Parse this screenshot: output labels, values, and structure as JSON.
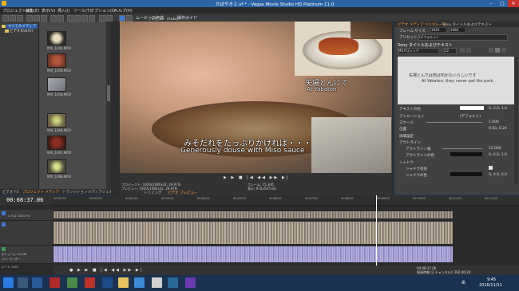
{
  "window": {
    "title": "かぼやき２.vf * - Vegas Movie Studio HD Platinum 11.0",
    "controls": [
      "–",
      "□",
      "✕"
    ]
  },
  "menu": [
    "プロジェクト(P)",
    "編集(E)",
    "表示(V)",
    "挿入(I)",
    "ツール(T)",
    "オプション(O)",
    "ヘルプ(H)"
  ],
  "toolbar": {
    "movie_maker_label": "ムービーの作成",
    "ops_guide_label": "操作ガイド"
  },
  "media_tree": {
    "items": [
      "すべてのメディア",
      "ビデオのみ(V)"
    ]
  },
  "media_files": [
    "MVI_1044.MOV",
    "MVI_1050.MOV",
    "MVI_1058.MOV",
    "MVI_1066.MOV",
    "MVI_1067.MOV",
    "MVI_1068.MOV"
  ],
  "left_tabs": [
    "ビデオ FX",
    "プロジェクト メディア",
    "トランジション",
    "メディアジェネレ"
  ],
  "preview": {
    "toolbar_label": "プレビュー (Auto)",
    "subtitle_jp_main": "みそだれをたっぷりかければ・・・",
    "subtitle_en_main": "Generously douse with Miso sauce",
    "inset_jp": "矢場とんにて",
    "inset_en": "At Yabaton.",
    "info_left_1": "プロジェクト: 1920x1080x32, 29.970i",
    "info_left_2": "プレビュー: 1920x1080x32, 29.970i",
    "info_left_3": "ビデオ プレビュー",
    "info_right_1": "フレーム: 15,300",
    "info_right_2": "表示: 970x547x32",
    "tabs": [
      "トリミング",
      "ビデオ プレビュー"
    ]
  },
  "inspector": {
    "tabs": [
      "ビデオ メディア ジェネレータ"
    ],
    "header": "Sony タイトルおよびテキスト",
    "frame_size_label": "フレーム サイズ",
    "frame_w": "1920",
    "frame_h": "1080",
    "preset_label": "プリセット",
    "preset_value": "(デフォルト)",
    "font_title": "Sony タイトルおよびテキスト",
    "font_name": "MS Pゴシック",
    "font_size": "12",
    "preview_jp": "矢場とんでは肉は叩かないらしいです",
    "preview_en": "At Yabaton, they never pat the pork.",
    "rows": [
      {
        "label": "テキストの色",
        "value": "0, 0.0, 1.0"
      },
      {
        "label": "アニメーション",
        "value": "(デフォルト)"
      },
      {
        "label": "スケール",
        "value": "1.000"
      },
      {
        "label": "位置",
        "value": "0.50, 0.24"
      },
      {
        "label": "詳細設定",
        "value": ""
      },
      {
        "label": "アウトライン",
        "value": ""
      },
      {
        "label": "アウトライン幅",
        "value": "15.000"
      },
      {
        "label": "アウトラインの色",
        "value": "0, 0.0, 1.0"
      },
      {
        "label": "シャドウ",
        "value": ""
      },
      {
        "label": "シャドウ有効",
        "value": ""
      },
      {
        "label": "シャドウの色",
        "value": "0, 0.0, 0.0"
      }
    ]
  },
  "timeline": {
    "timecode": "00:08:37.06",
    "ruler": [
      "00:00:00",
      "00:01:00",
      "00:02:00",
      "00:03:00",
      "00:04:00",
      "00:05:00",
      "00:06:00",
      "00:07:00",
      "00:08:00",
      "00:09:00",
      "00:10:00",
      "00:11:00",
      "00:12:00"
    ],
    "track_labels": [
      "レベル: 100.0 %",
      "ボリューム: 0.0 dB",
      "パン: センター"
    ],
    "rate_label": "レート: 0.00",
    "status_time": "00:08:37.06",
    "status_record": "録画時間 (2 チャンネル): 262:46:20"
  },
  "taskbar": {
    "time": "9:45",
    "date": "2016/11/11",
    "ime": "あ"
  },
  "colors": {
    "title_bar": "#2b63a6",
    "accent_orange": "#ff9a3c",
    "panel_dark": "#3c3c3c"
  }
}
